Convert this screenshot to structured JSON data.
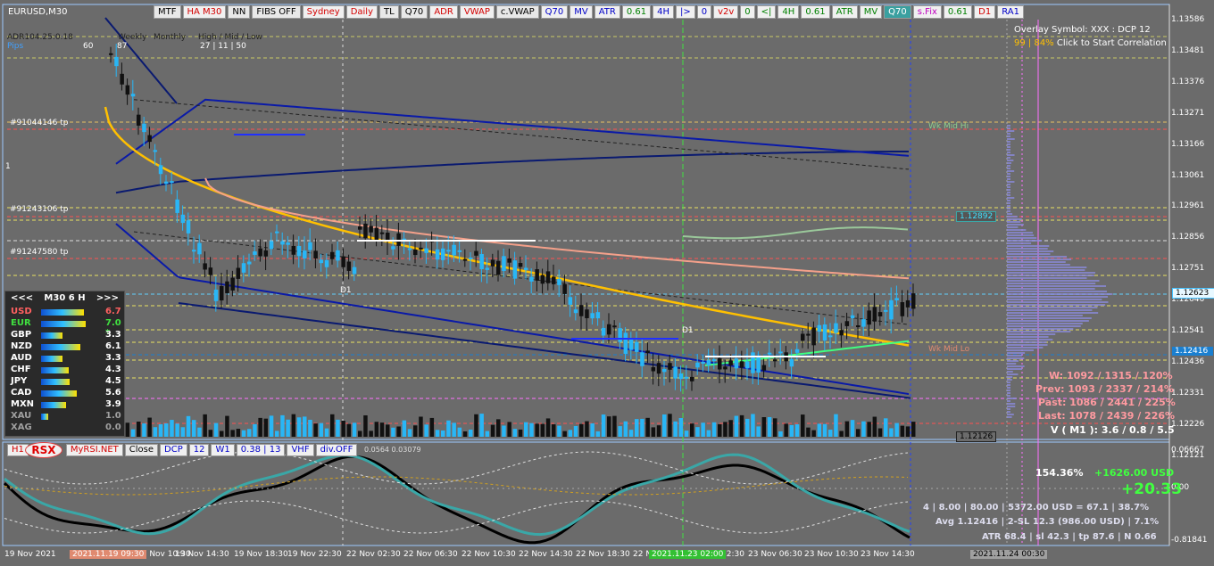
{
  "symbol": "EURUSD,M30",
  "toolbar": [
    {
      "label": "MTF",
      "cls": "dark"
    },
    {
      "label": "HA M30",
      "cls": "red"
    },
    {
      "label": "NN",
      "cls": "dark"
    },
    {
      "label": "FIBS OFF",
      "cls": "dark"
    },
    {
      "label": "Sydney",
      "cls": "red"
    },
    {
      "label": "Daily",
      "cls": "red"
    },
    {
      "label": "TL",
      "cls": "dark"
    },
    {
      "label": "Q70",
      "cls": "dark"
    },
    {
      "label": "ADR",
      "cls": "red"
    },
    {
      "label": "VWAP",
      "cls": "red"
    },
    {
      "label": "c.VWAP",
      "cls": "dark"
    },
    {
      "label": "Q70",
      "cls": "blue"
    },
    {
      "label": "MV",
      "cls": "blue"
    },
    {
      "label": "ATR",
      "cls": "blue"
    },
    {
      "label": "0.61",
      "cls": "green"
    },
    {
      "label": "4H",
      "cls": "blue"
    },
    {
      "label": "|>",
      "cls": "blue"
    },
    {
      "label": "0",
      "cls": "blue"
    },
    {
      "label": "v2v",
      "cls": "red"
    },
    {
      "label": "0",
      "cls": "green"
    },
    {
      "label": "<|",
      "cls": "green"
    },
    {
      "label": "4H",
      "cls": "green"
    },
    {
      "label": "0.61",
      "cls": "green"
    },
    {
      "label": "ATR",
      "cls": "green"
    },
    {
      "label": "MV",
      "cls": "green"
    },
    {
      "label": "Q70",
      "cls": "tealbg"
    },
    {
      "label": "s.Fix",
      "cls": "mag"
    },
    {
      "label": "0.61",
      "cls": "green"
    },
    {
      "label": "D1",
      "cls": "red"
    },
    {
      "label": "RA1",
      "cls": "blue"
    }
  ],
  "header_labels": {
    "row1": [
      "Weekly",
      "Monthly",
      "High / Mid / Low"
    ],
    "row2": [
      "60",
      "87",
      "27 | 11 | 50"
    ],
    "left": "ADR104.25:0.18",
    "pips": "Pips"
  },
  "overlay": {
    "line1": "Overlay Symbol: XXX : DCP 12",
    "line2_a": "99 | 84%",
    "line2_b": " Click to Start Correlation"
  },
  "tp_labels": [
    "#91044146 tp",
    "#91243106 tp",
    "#91247580 tp"
  ],
  "marker_one": "1",
  "d1_labels": [
    "D1",
    "D1"
  ],
  "wk_mid_hi": "Wk Mid Hi",
  "wk_mid_lo": "Wk Mid Lo",
  "price_axis": [
    "1.13586",
    "1.13481",
    "1.13376",
    "1.13271",
    "1.13166",
    "1.13061",
    "1.12961",
    "1.12856",
    "1.12751",
    "1.12646",
    "1.12541",
    "1.12436",
    "1.12331",
    "1.12226",
    "1.12121"
  ],
  "price_badges": {
    "current": "1.12623",
    "blue": "1.12416",
    "line": "1.12892",
    "low": "1.12126"
  },
  "osc_axis": [
    "0.06667",
    "0.00",
    "-0.81841"
  ],
  "time_axis": [
    "19 Nov 2021",
    "19 Nov 10:30",
    "19 Nov 14:30",
    "19 Nov 18:30",
    "19 Nov 22:30",
    "22 Nov 02:30",
    "22 Nov 06:30",
    "22 Nov 10:30",
    "22 Nov 14:30",
    "22 Nov 18:30",
    "22 N",
    "02:30",
    "23 Nov 06:30",
    "23 Nov 10:30",
    "23 Nov 14:30"
  ],
  "time_badges": {
    "left": "2021.11.19 09:30",
    "mid": "2021.11.23 02:00",
    "right": "2021.11.24 00:30"
  },
  "currency_panel": {
    "title": "M30 6 H",
    "prev": "<<<",
    "next": ">>>",
    "rows": [
      {
        "name": "USD",
        "value": "6.7",
        "color": "#ff6060",
        "bar": 48
      },
      {
        "name": "EUR",
        "value": "7.0 *",
        "color": "#40e040",
        "bar": 50
      },
      {
        "name": "GBP",
        "value": "3.3",
        "color": "#ffffff",
        "bar": 24
      },
      {
        "name": "NZD",
        "value": "6.1",
        "color": "#ffffff",
        "bar": 44
      },
      {
        "name": "AUD",
        "value": "3.3",
        "color": "#ffffff",
        "bar": 24
      },
      {
        "name": "CHF",
        "value": "4.3",
        "color": "#ffffff",
        "bar": 31
      },
      {
        "name": "JPY",
        "value": "4.5",
        "color": "#ffffff",
        "bar": 32
      },
      {
        "name": "CAD",
        "value": "5.6",
        "color": "#ffffff",
        "bar": 40
      },
      {
        "name": "MXN",
        "value": "3.9",
        "color": "#ffffff",
        "bar": 28
      },
      {
        "name": "XAU",
        "value": "1.0",
        "color": "#a0a0a0",
        "bar": 8
      },
      {
        "name": "XAG",
        "value": "0.0",
        "color": "#a0a0a0",
        "bar": 0
      }
    ]
  },
  "sub_toolbar": [
    "H1",
    "MyRSI.NET",
    "Close",
    "DCP",
    "12",
    "W1",
    "0.38 | 13",
    "VHF",
    "div.OFF"
  ],
  "rsx": "RSX",
  "osc_readout": "0.0564 0.03079",
  "stats_right": [
    {
      "text": "W: 1092 / 1315 / 120%",
      "color": "#ff9aa0"
    },
    {
      "text": "Prev: 1093 / 2337 / 214%",
      "color": "#ff9aa0"
    },
    {
      "text": "Past: 1086 / 2441 / 225%",
      "color": "#ff9aa0"
    },
    {
      "text": "Last: 1078 / 2439 / 226%",
      "color": "#ff9aa0"
    },
    {
      "text": "V ( M1 ): 3.6 / 0.8 / 5.5",
      "color": "#ffffff"
    }
  ],
  "pnl": {
    "pct": "154.36%",
    "usd": "+1626.00 USD",
    "big": "+20.33"
  },
  "trade_lines": [
    "4  |  8.00  |  80.00  |  5372.00 USD = 67.1  |  38.7%",
    "Avg 1.12416  |  2-SL 12.3 (986.00 USD)  |  7.1%",
    "ATR 68.4  |  sl 42.3  |  tp 87.6  |  N 0.66"
  ],
  "colors": {
    "bg": "#6b6b6b",
    "bull": "#29b6f6",
    "bear": "#111111",
    "vwap": "#ffc000",
    "salmon": "#f4a08a",
    "navy": "#0a1aa8",
    "teal": "#3aa7a7"
  }
}
